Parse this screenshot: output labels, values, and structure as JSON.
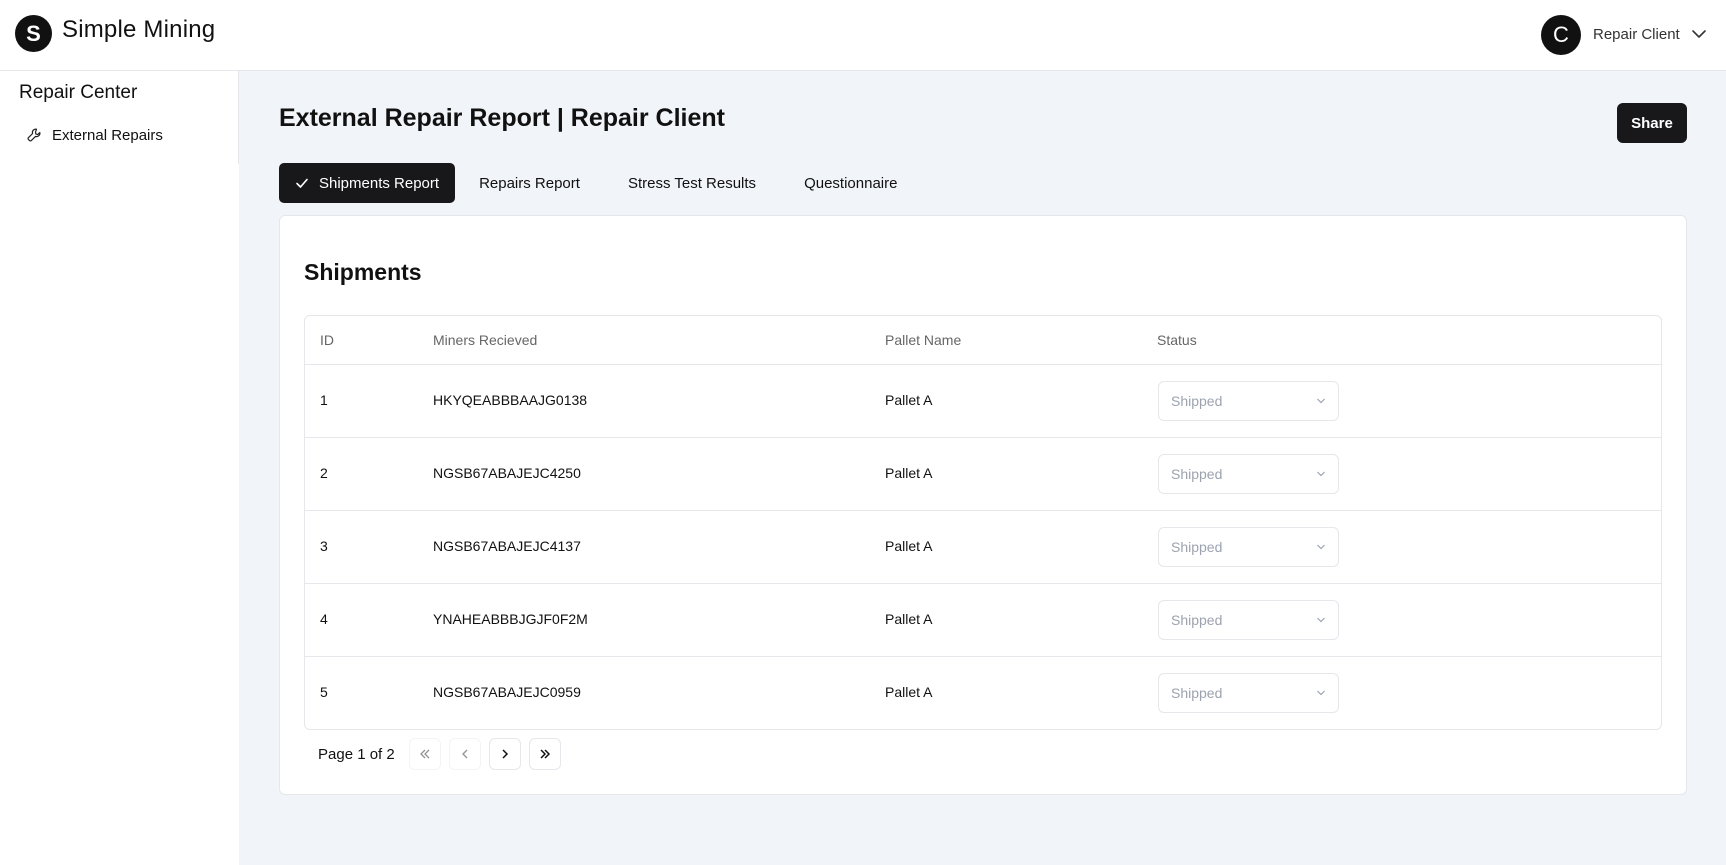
{
  "app": {
    "logo_letter": "S",
    "brand_name": "Simple Mining"
  },
  "user": {
    "avatar_letter": "C",
    "name": "Repair Client"
  },
  "sidebar": {
    "title": "Repair Center",
    "items": [
      {
        "label": "External Repairs",
        "icon": "wrench-icon"
      }
    ]
  },
  "page": {
    "title": "External Repair Report | Repair Client",
    "share_label": "Share"
  },
  "tabs": [
    {
      "label": "Shipments Report",
      "active": true
    },
    {
      "label": "Repairs Report",
      "active": false
    },
    {
      "label": "Stress Test Results",
      "active": false
    },
    {
      "label": "Questionnaire",
      "active": false
    }
  ],
  "shipments": {
    "title": "Shipments",
    "columns": [
      "ID",
      "Miners Recieved",
      "Pallet Name",
      "Status"
    ],
    "rows": [
      {
        "id": "1",
        "miner": "HKYQEABBBAAJG0138",
        "pallet": "Pallet A",
        "status": "Shipped"
      },
      {
        "id": "2",
        "miner": "NGSB67ABAJEJC4250",
        "pallet": "Pallet A",
        "status": "Shipped"
      },
      {
        "id": "3",
        "miner": "NGSB67ABAJEJC4137",
        "pallet": "Pallet A",
        "status": "Shipped"
      },
      {
        "id": "4",
        "miner": "YNAHEABBBJGJF0F2M",
        "pallet": "Pallet A",
        "status": "Shipped"
      },
      {
        "id": "5",
        "miner": "NGSB67ABAJEJC0959",
        "pallet": "Pallet A",
        "status": "Shipped"
      }
    ]
  },
  "pagination": {
    "label": "Page 1 of 2"
  },
  "colors": {
    "accent": "#18181b",
    "background": "#f1f4f8",
    "border": "#e5e7eb",
    "muted_text": "#9ca3af"
  }
}
